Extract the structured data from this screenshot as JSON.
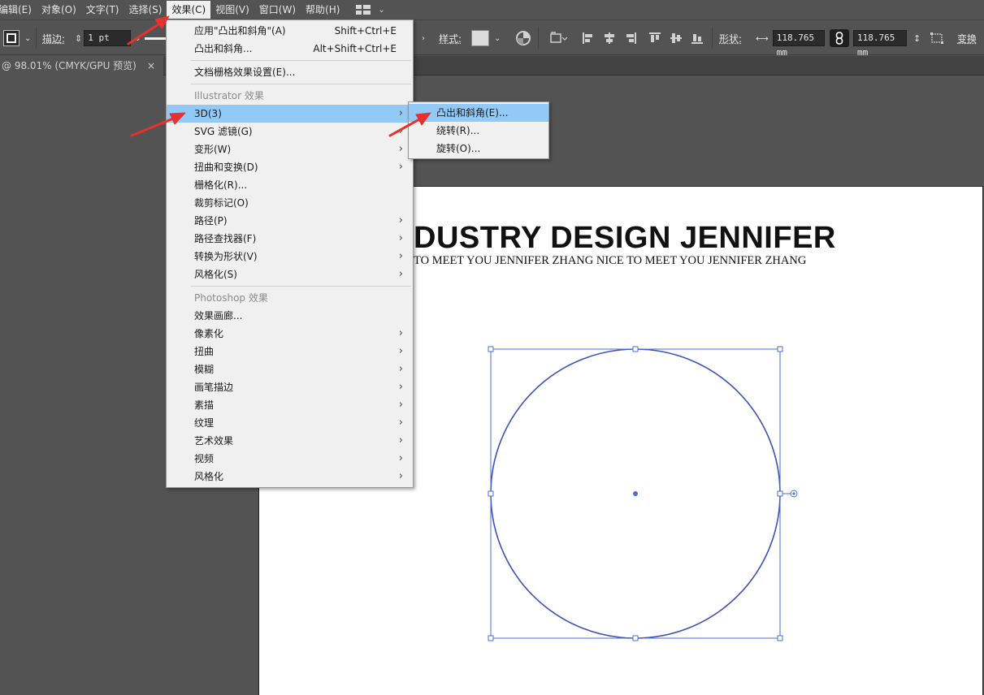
{
  "menubar": {
    "items": [
      {
        "label": "编辑(E)",
        "name": "menu-edit"
      },
      {
        "label": "对象(O)",
        "name": "menu-object"
      },
      {
        "label": "文字(T)",
        "name": "menu-type"
      },
      {
        "label": "选择(S)",
        "name": "menu-select"
      },
      {
        "label": "效果(C)",
        "name": "menu-effect"
      },
      {
        "label": "视图(V)",
        "name": "menu-view"
      },
      {
        "label": "窗口(W)",
        "name": "menu-window"
      },
      {
        "label": "帮助(H)",
        "name": "menu-help"
      }
    ],
    "active": "menu-effect"
  },
  "controlbar": {
    "stroke_label": "描边:",
    "stroke_value": "1 pt",
    "style_label": "样式:",
    "shape_label": "形状:",
    "width_value": "118.765 mm",
    "height_value": "118.765 mm",
    "transform_label": "变换"
  },
  "tab": {
    "title": "@ 98.01% (CMYK/GPU 预览)",
    "close": "×"
  },
  "effect_menu": {
    "apply_last": "应用\"凸出和斜角\"(A)",
    "apply_last_shortcut": "Shift+Ctrl+E",
    "last_effect": "凸出和斜角...",
    "last_effect_shortcut": "Alt+Shift+Ctrl+E",
    "doc_raster": "文档栅格效果设置(E)...",
    "illustrator_header": "Illustrator 效果",
    "illustrator_items": [
      "3D(3)",
      "SVG 滤镜(G)",
      "变形(W)",
      "扭曲和变换(D)",
      "栅格化(R)...",
      "裁剪标记(O)",
      "路径(P)",
      "路径查找器(F)",
      "转换为形状(V)",
      "风格化(S)"
    ],
    "photoshop_header": "Photoshop 效果",
    "photoshop_items": [
      "效果画廊...",
      "像素化",
      "扭曲",
      "模糊",
      "画笔描边",
      "素描",
      "纹理",
      "艺术效果",
      "视频",
      "风格化"
    ]
  },
  "submenu_3d": {
    "items": [
      "凸出和斜角(E)...",
      "绕转(R)...",
      "旋转(O)..."
    ]
  },
  "artboard": {
    "title": "DUSTRY DESIGN JENNIFER",
    "subtitle": "TO MEET YOU JENNIFER ZHANG  NICE TO MEET YOU JENNIFER ZHANG"
  },
  "colors": {
    "selection": "#3d63d6",
    "highlight": "#91c9f7",
    "arrow": "#e8312f"
  }
}
